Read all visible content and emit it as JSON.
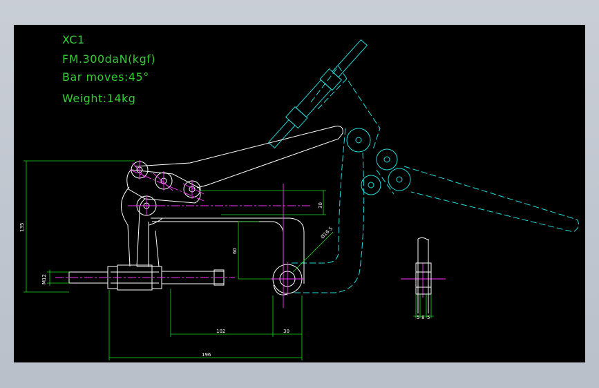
{
  "notes": {
    "model": "XC1",
    "force": "FM.300daN(kgf)",
    "bar": "Bar moves:45°",
    "weight": "Weight:14kg"
  },
  "dims": {
    "height": "135",
    "thread": "M12",
    "d102": "102",
    "d30b": "30",
    "d196": "196",
    "d60": "60",
    "d30r": "30",
    "dia": "Ø16.5",
    "s1": "5",
    "s2": "8",
    "s3": "5"
  },
  "colors": {
    "background": "#000000",
    "outline": "#ffffff",
    "dimension": "#22dd22",
    "centerline": "#ff33ff",
    "phantom": "#22dddd",
    "frame": "#c9ced6"
  }
}
